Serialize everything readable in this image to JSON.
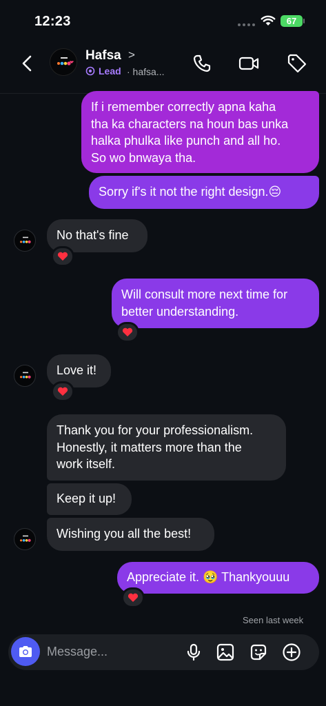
{
  "status_bar": {
    "time": "12:23",
    "battery": "67"
  },
  "header": {
    "name": "Hafsa",
    "name_chevron": ">",
    "lead_label": "Lead",
    "handle": "· hafsa..."
  },
  "messages": [
    {
      "side": "out",
      "lines": [
        "If i remember correctly apna kaha",
        "tha ka characters na houn bas unka",
        "halka phulka like punch and all ho.",
        "So wo bnwaya tha."
      ]
    },
    {
      "side": "out",
      "lines": [
        "Sorry if's it not the right design.😔"
      ]
    },
    {
      "side": "in",
      "lines": [
        "No that's fine"
      ],
      "reaction": "❤️"
    },
    {
      "side": "out",
      "lines": [
        "Will consult more next time for",
        "better understanding."
      ],
      "reaction": "❤️"
    },
    {
      "side": "in",
      "lines": [
        "Love it!"
      ],
      "reaction": "❤️"
    },
    {
      "side": "in",
      "lines": [
        "Thank you for your professionalism.",
        "Honestly, it matters more than the",
        "work itself."
      ]
    },
    {
      "side": "in",
      "lines": [
        "Keep it up!"
      ]
    },
    {
      "side": "in",
      "lines": [
        "Wishing you all the best!"
      ]
    },
    {
      "side": "out",
      "lines": [
        "Appreciate it. 🥹 Thankyouuu"
      ],
      "reaction": "❤️"
    }
  ],
  "seen_text": "Seen last week",
  "composer": {
    "placeholder": "Message..."
  },
  "colors": {
    "background": "#0c0f14",
    "outgoing_bubble": "#8a3ae8",
    "incoming_bubble": "#26282d",
    "accent": "#4f5bf2",
    "heart": "#ff3040",
    "battery": "#4cd964"
  },
  "icons": [
    "back-chevron-icon",
    "phone-icon",
    "video-camera-icon",
    "tag-icon",
    "camera-icon",
    "microphone-icon",
    "gallery-icon",
    "sticker-icon",
    "plus-circle-icon"
  ]
}
